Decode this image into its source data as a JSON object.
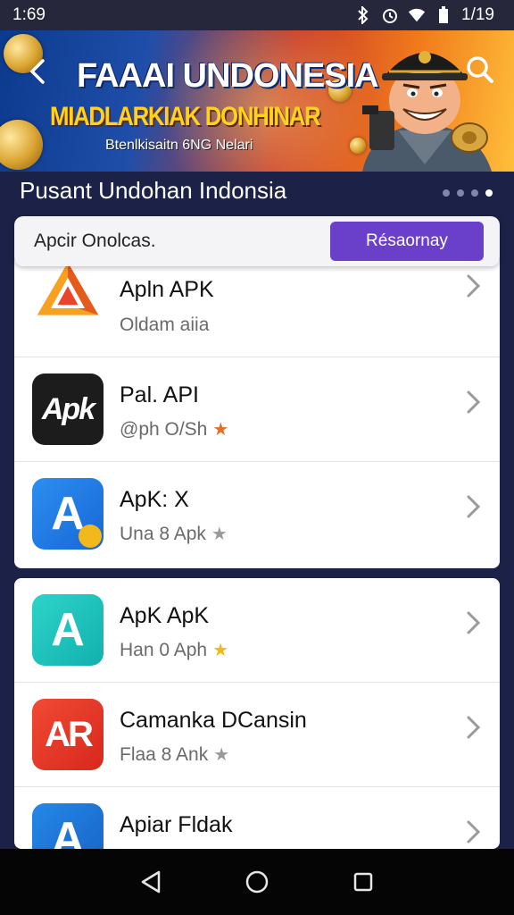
{
  "status_bar": {
    "time": "1:69",
    "battery": "1/19"
  },
  "banner": {
    "title": "FAAAI UNDONESIA",
    "subtitle": "MIADLARKIAK DONHINAR",
    "caption": "Btenlkisaitn 6NG Nelari"
  },
  "section": {
    "title": "Pusant Undohan Indonsia"
  },
  "promo": {
    "text": "Apcir Onolcas.",
    "button_label": "Résaornay"
  },
  "apps": [
    {
      "name": "Apln APK",
      "subtitle": "Oldam aiia",
      "star": "",
      "icon_text": "",
      "icon_colors": [
        "#ffffff",
        "#ffffff"
      ],
      "star_color": ""
    },
    {
      "name": "Pal. API",
      "subtitle": "@ph O/Sh",
      "star": "★",
      "icon_text": "Apk",
      "icon_colors": [
        "#1c1c1c",
        "#1c1c1c"
      ],
      "star_color": "#e07028"
    },
    {
      "name": "ApK: X",
      "subtitle": "Una 8 Apk",
      "star": "★",
      "icon_text": "A",
      "icon_colors": [
        "#2c8ef0",
        "#1767d6"
      ],
      "star_color": "#9a9a9a"
    },
    {
      "name": "ApK ApK",
      "subtitle": "Han 0 Aph",
      "star": "★",
      "icon_text": "A",
      "icon_colors": [
        "#2dd4c8",
        "#12b0ae"
      ],
      "star_color": "#f2b81c"
    },
    {
      "name": "Camanka DCansin",
      "subtitle": "Flaa 8 Ank",
      "star": "★",
      "icon_text": "AR",
      "icon_colors": [
        "#f04a34",
        "#d8281c"
      ],
      "star_color": "#9a9a9a"
    },
    {
      "name": "Apiar Fldak",
      "subtitle": "",
      "star": "",
      "icon_text": "A",
      "icon_colors": [
        "#2488e8",
        "#1762c4"
      ],
      "star_color": ""
    }
  ],
  "icons": {
    "back": "back-arrow-icon",
    "search": "search-icon",
    "chevron": "chevron-right-icon",
    "nav_back": "nav-back-icon",
    "nav_home": "nav-home-icon",
    "nav_recents": "nav-recents-icon"
  },
  "colors": {
    "background": "#1c2147",
    "accent": "#6a3fc9"
  }
}
